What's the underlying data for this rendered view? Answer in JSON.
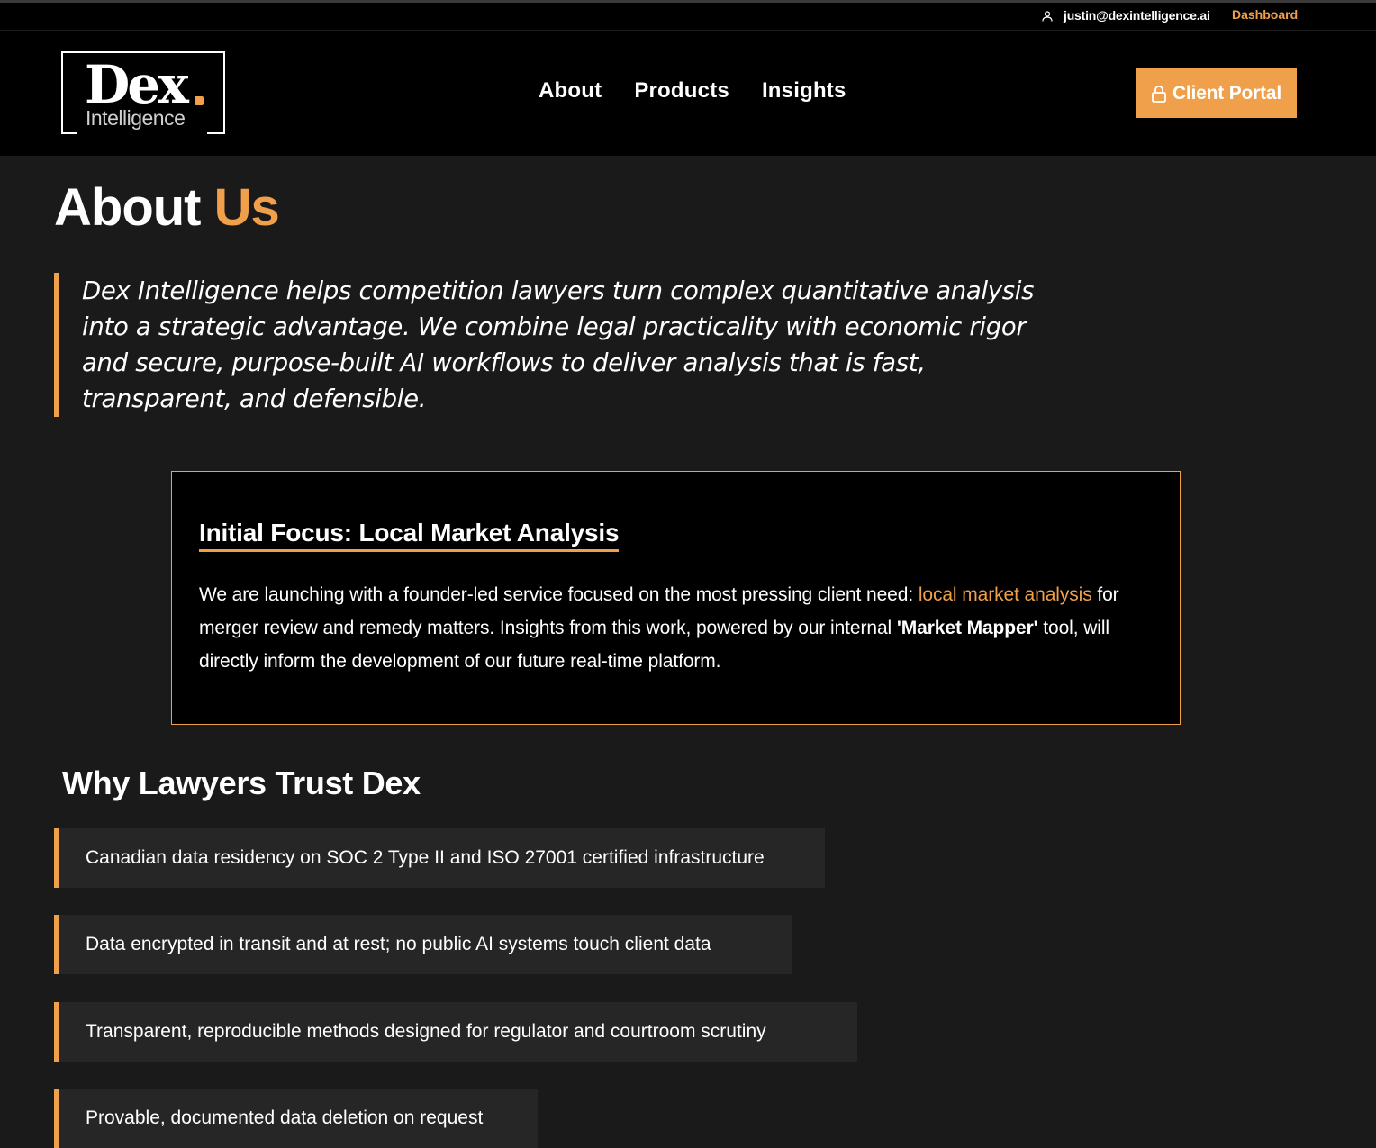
{
  "topbar": {
    "user_icon": "user-icon",
    "email": "justin@dexintelligence.ai",
    "dashboard_label": "Dashboard"
  },
  "header": {
    "logo": {
      "main": "Dex",
      "sub": "Intelligence"
    },
    "nav": [
      {
        "label": "About"
      },
      {
        "label": "Products"
      },
      {
        "label": "Insights"
      }
    ],
    "portal_button": {
      "icon": "lock-icon",
      "label": "Client Portal"
    }
  },
  "about": {
    "title_main": "About",
    "title_accent": "Us",
    "intro": "Dex Intelligence helps competition lawyers turn complex quantitative analysis into a strategic advantage. We combine legal practicality with economic rigor and secure, purpose-built AI workflows to deliver analysis that is fast, transparent, and defensible."
  },
  "focus": {
    "title": "Initial Focus: Local Market Analysis",
    "text_part1": "We are launching with a founder-led service focused on the most pressing client need: ",
    "text_highlight": "local market analysis",
    "text_part2": " for merger review and remedy matters. Insights from this work, powered by our internal ",
    "text_strong": "'Market Mapper'",
    "text_part3": " tool, will directly inform the development of our future real-time platform."
  },
  "trust": {
    "title": "Why Lawyers Trust Dex",
    "items": [
      "Canadian data residency on SOC 2 Type II and ISO 27001 certified infrastructure",
      "Data encrypted in transit and at rest; no public AI systems touch client data",
      "Transparent, reproducible methods designed for regulator and courtroom scrutiny",
      "Provable, documented data deletion on request"
    ]
  },
  "colors": {
    "accent": "#f0a04b",
    "background": "#1a1a1a",
    "header_bg": "#000000"
  }
}
